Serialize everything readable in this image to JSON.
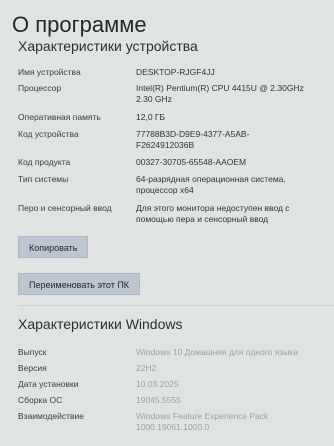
{
  "page": {
    "title": "О программе"
  },
  "device_specs": {
    "heading": "Характеристики устройства",
    "rows": [
      {
        "label": "Имя устройства",
        "value": "DESKTOP-RJGF4JJ"
      },
      {
        "label": "Процессор",
        "value": "Intel(R) Pentium(R) CPU 4415U @ 2.30GHz\n2.30 GHz"
      },
      {
        "label": "Оперативная память",
        "value": "12,0 ГБ"
      },
      {
        "label": "Код устройства",
        "value": "77788B3D-D9E9-4377-A5AB-\nF2624912036B"
      },
      {
        "label": "Код продукта",
        "value": "00327-30705-65548-AAOEM"
      },
      {
        "label": "Тип системы",
        "value": "64-разрядная операционная система,\nпроцессор x64"
      },
      {
        "label": "Перо и сенсорный ввод",
        "value": "Для этого монитора недоступен ввод с\nпомощью пера и сенсорный ввод"
      }
    ],
    "copy_button": "Копировать",
    "rename_button": "Переименовать этот ПК"
  },
  "windows_specs": {
    "heading": "Характеристики Windows",
    "rows": [
      {
        "label": "Выпуск",
        "value": "Windows 10 Домашняя для одного языка"
      },
      {
        "label": "Версия",
        "value": "22H2"
      },
      {
        "label": "Дата установки",
        "value": "10.03.2025"
      },
      {
        "label": "Сборка ОС",
        "value": "19045.5555"
      },
      {
        "label": "Взаимодействие",
        "value": "Windows Feature Experience Pack\n1000.19061.1000.0"
      }
    ]
  }
}
